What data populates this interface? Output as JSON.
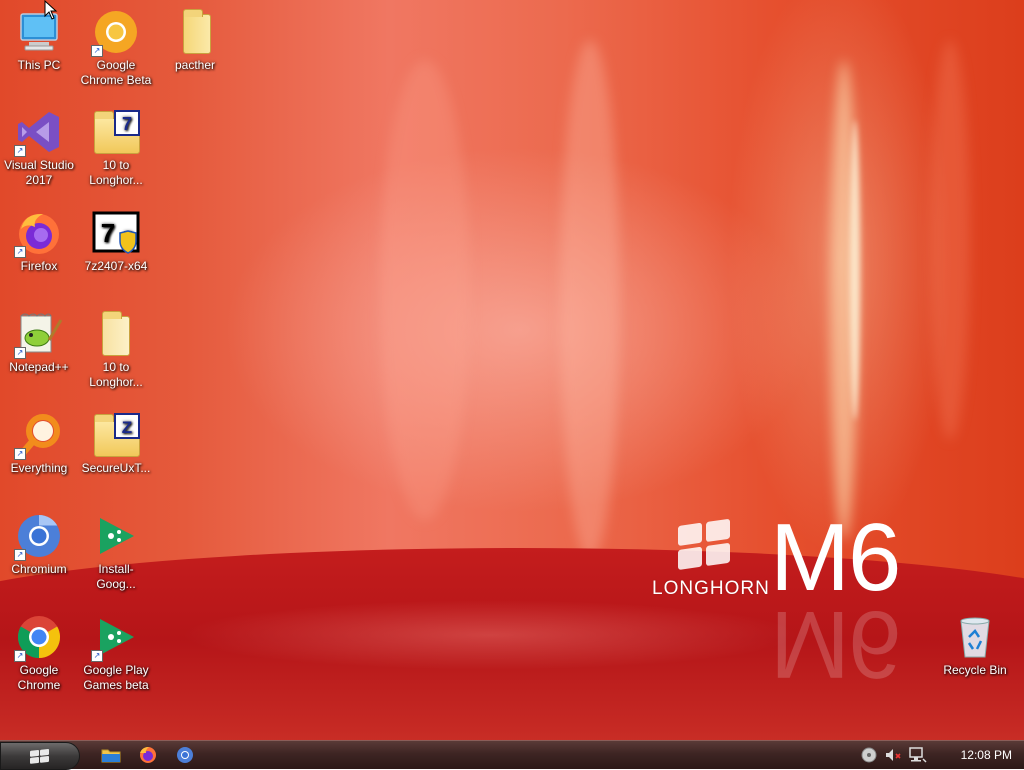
{
  "desktop": {
    "icons": [
      {
        "label": "This PC"
      },
      {
        "label": "Google Chrome Beta"
      },
      {
        "label": "pacther"
      },
      {
        "label": "Visual Studio 2017"
      },
      {
        "label": "10 to Longhor..."
      },
      {
        "label": "Firefox"
      },
      {
        "label": "7z2407-x64"
      },
      {
        "label": "Notepad++"
      },
      {
        "label": "10 to Longhor..."
      },
      {
        "label": "Everything"
      },
      {
        "label": "SecureUxT..."
      },
      {
        "label": "Chromium"
      },
      {
        "label": "Install-Goog..."
      },
      {
        "label": "Google Chrome"
      },
      {
        "label": "Google Play Games beta"
      },
      {
        "label": "Recycle Bin"
      }
    ],
    "wallpaper": {
      "brand": "LONGHORN",
      "edition": "M6"
    }
  },
  "taskbar": {
    "pinned": [
      {
        "icon": "file-explorer-icon"
      },
      {
        "icon": "firefox-icon"
      },
      {
        "icon": "chromium-icon"
      }
    ],
    "tray": {
      "clock": "12:08 PM"
    }
  },
  "colors": {
    "wallpaper_accent": "#e55a3c",
    "floor_red": "#b51518",
    "taskbar": "#3e2523"
  }
}
